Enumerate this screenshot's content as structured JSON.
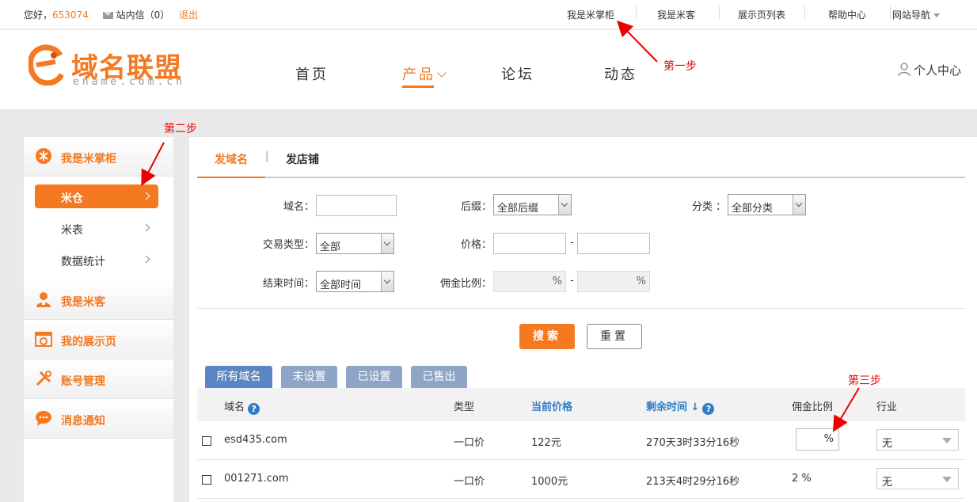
{
  "topbar": {
    "greeting": "您好，",
    "user_id": "653074",
    "inbox_label": "站内信",
    "inbox_count": "（0）",
    "logout": "退出",
    "nav": [
      "我是米掌柜",
      "我是米客",
      "展示页列表",
      "帮助中心",
      "网站导航"
    ]
  },
  "logo": {
    "cn": "域名联盟",
    "en": "ename.com.cn"
  },
  "mainnav": [
    "首页",
    "产品",
    "论坛",
    "动态"
  ],
  "personal_center": "个人中心",
  "annotations": {
    "step1": "第一步",
    "step2": "第二步",
    "step3": "第三步"
  },
  "sidebar": {
    "sections": [
      "我是米掌柜",
      "我是米客",
      "我的展示页",
      "账号管理",
      "消息通知"
    ],
    "items": [
      "米仓",
      "米表",
      "数据统计"
    ]
  },
  "tabs": [
    "发域名",
    "发店铺"
  ],
  "tab_separator": "|",
  "form": {
    "domain_label": "域名：",
    "suffix_label": "后缀：",
    "suffix_value": "全部后缀",
    "category_label": "分类 ：",
    "category_value": "全部分类",
    "trade_type_label": "交易类型：",
    "trade_type_value": "全部",
    "price_label": "价格：",
    "end_time_label": "结束时间：",
    "end_time_value": "全部时间",
    "commission_label": "佣金比例：",
    "percent": "%",
    "dash": "-"
  },
  "buttons": {
    "search": "搜索",
    "reset": "重置"
  },
  "filter_tabs": [
    "所有域名",
    "未设置",
    "已设置",
    "已售出"
  ],
  "table": {
    "headers": {
      "domain": "域名",
      "type": "类型",
      "price": "当前价格",
      "remaining": "剩余时间",
      "sort_arrow": "↓",
      "commission": "佣金比例",
      "industry": "行业"
    },
    "help_glyph": "?",
    "rows": [
      {
        "domain": "esd435.com",
        "type": "一口价",
        "price": "122元",
        "remaining": "270天3时33分16秒",
        "commission": "%",
        "industry": "无"
      },
      {
        "domain": "001271.com",
        "type": "一口价",
        "price": "1000元",
        "remaining": "213天4时29分16秒",
        "commission": "2 %",
        "industry": "无"
      }
    ]
  },
  "colors": {
    "accent": "#f47920",
    "tab_blue": "#5b86c5",
    "link_blue": "#2f7cc7",
    "annotation": "#e00000"
  }
}
